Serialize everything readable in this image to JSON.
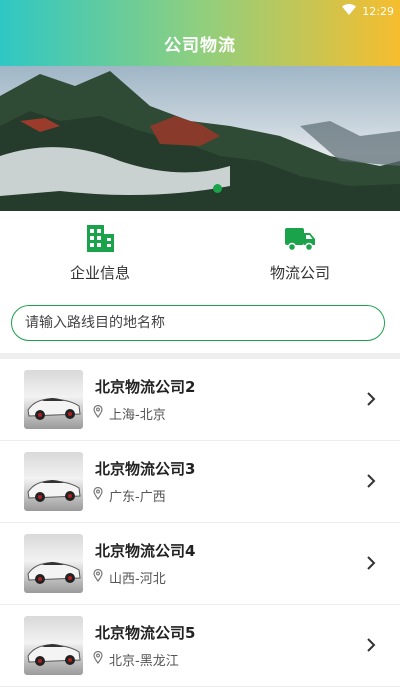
{
  "status_bar": {
    "time": "12:29"
  },
  "header": {
    "title": "公司物流"
  },
  "banner": {
    "active_slide": 1,
    "slide_count": 1
  },
  "features": [
    {
      "label": "企业信息",
      "icon": "building-icon"
    },
    {
      "label": "物流公司",
      "icon": "truck-icon"
    }
  ],
  "search": {
    "placeholder": "请输入路线目的地名称",
    "value": ""
  },
  "companies": [
    {
      "name": "北京物流公司2",
      "route": "上海-北京"
    },
    {
      "name": "北京物流公司3",
      "route": "广东-广西"
    },
    {
      "name": "北京物流公司4",
      "route": "山西-河北"
    },
    {
      "name": "北京物流公司5",
      "route": "北京-黑龙江"
    }
  ],
  "colors": {
    "accent": "#1aa34a",
    "header_gradient": [
      "#2fc7c4",
      "#f6bd2e"
    ]
  }
}
